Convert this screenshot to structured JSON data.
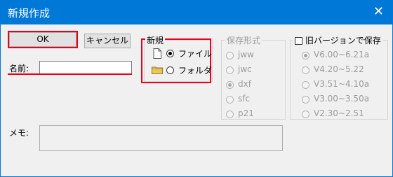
{
  "window": {
    "title": "新規作成",
    "close_glyph": "✕"
  },
  "buttons": {
    "ok": "OK",
    "cancel": "キャンセル"
  },
  "name_field": {
    "label": "名前:",
    "value": ""
  },
  "new_group": {
    "legend": "新規",
    "options": [
      {
        "label": "ファイル",
        "selected": true,
        "icon": "file-icon"
      },
      {
        "label": "フォルダ",
        "selected": false,
        "icon": "folder-icon"
      }
    ]
  },
  "format_group": {
    "legend": "保存形式",
    "options": [
      {
        "label": "jww",
        "selected": false
      },
      {
        "label": "jwc",
        "selected": false
      },
      {
        "label": "dxf",
        "selected": true
      },
      {
        "label": "sfc",
        "selected": false
      },
      {
        "label": "p21",
        "selected": false
      }
    ]
  },
  "version_group": {
    "legend": "旧バージョンで保存",
    "checked": false,
    "options": [
      {
        "label": "V6.00~6.21a",
        "selected": true
      },
      {
        "label": "V4.20~5.22",
        "selected": false
      },
      {
        "label": "V3.51~4.10a",
        "selected": false
      },
      {
        "label": "V3.00~3.50a",
        "selected": false
      },
      {
        "label": "V2.30~2.51",
        "selected": false
      }
    ]
  },
  "memo": {
    "label": "メモ:",
    "value": ""
  },
  "colors": {
    "titlebar": "#0078d7",
    "highlight": "#e8001c"
  }
}
